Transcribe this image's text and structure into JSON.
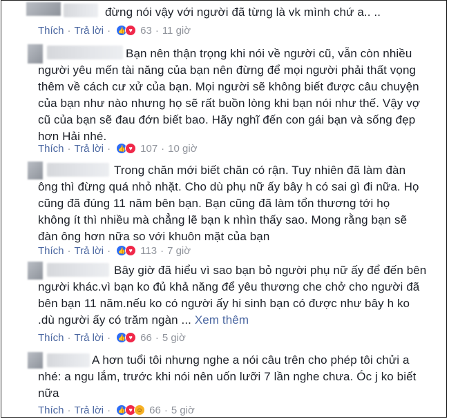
{
  "comments": [
    {
      "text": "đừng nói vậy với người đã từng là vk mình chứ a.. ..",
      "like_label": "Thích",
      "reply_label": "Trả lời",
      "reactions": [
        "like",
        "love"
      ],
      "count": "63",
      "time": "11 giờ"
    },
    {
      "text": "Bạn nên thận trọng khi nói về người cũ, vẫn còn nhiều\nngười yêu mến tài năng của bạn nên đừng để mọi người phải thất vọng\nthêm về cách cư xử của bạn. Mọi người sẽ không biết được câu chuyện\ncủa bạn như nào nhưng họ sẽ rất buồn lòng khi bạn nói như thế. Vậy vợ\ncũ của bạn sẽ đau đớn biết bao. Hãy nghĩ đến con gái bạn và sống đẹp\nhơn Hải nhé.",
      "like_label": "Thích",
      "reply_label": "Trả lời",
      "reactions": [
        "like",
        "love"
      ],
      "count": "107",
      "time": "10 giờ"
    },
    {
      "text": "Trong chăn mới biết chăn có rận. Tuy nhiên đã làm đàn\nông thì đừng quá nhỏ nhặt. Cho dù phụ nữ ấy bây h có sai gì đi nữa. Họ\ncũng đã đúng 11 năm bên bạn. Bạn cũng đã làm tổn thương tới họ\nkhông ít thì nhiều mà chẳng lẽ bạn k nhìn thấy sao. Mong rằng bạn sẽ\nđàn ông hơn nữa so với khuôn mặt của bạn",
      "like_label": "Thích",
      "reply_label": "Trả lời",
      "reactions": [
        "like",
        "love"
      ],
      "count": "113",
      "time": "7 giờ"
    },
    {
      "text": "Bây giờ đã hiểu vì sao bạn bỏ người phụ nữ ấy để đến bên\nngười khác.vì bạn ko đủ khả năng để yêu thương che chở cho người đã\nbên bạn 11 năm.nếu ko có người ấy hi sinh bạn có được như bây h ko\n.dù người ấy có trăm ngàn ...",
      "see_more": "Xem thêm",
      "like_label": "Thích",
      "reply_label": "Trả lời",
      "reactions": [
        "like",
        "love"
      ],
      "count": "66",
      "time": "5 giờ"
    },
    {
      "text": "A hơn tuổi tôi nhưng nghe a nói câu trên cho phép tôi chửi a\nnhé: a ngu lắm, trước khi nói nên uốn lưỡi 7 lần nghe chưa. Óc j ko biết\nnữa",
      "like_label": "Thích",
      "reply_label": "Trả lời",
      "reactions": [
        "like",
        "love",
        "haha"
      ],
      "count": "66",
      "time": "5 giờ"
    }
  ]
}
